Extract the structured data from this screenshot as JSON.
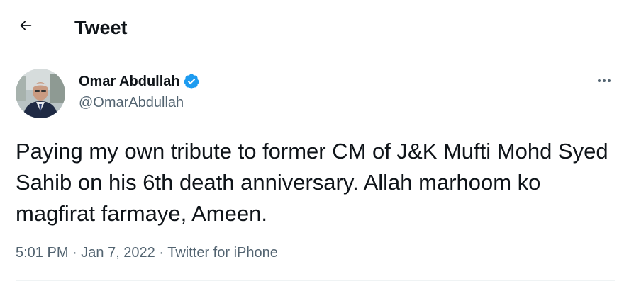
{
  "header": {
    "title": "Tweet",
    "back_icon": "arrow-left-icon"
  },
  "author": {
    "display_name": "Omar Abdullah",
    "handle": "@OmarAbdullah",
    "verified_icon": "verified-badge-icon",
    "verified_color": "#1d9bf0",
    "more_icon": "more-horizontal-icon"
  },
  "tweet": {
    "text": "Paying my own tribute to former CM of J&K Mufti Mohd Syed Sahib on his 6th death anniversary. Allah marhoom ko magfirat farmaye, Ameen.",
    "time": "5:01 PM",
    "separator": "·",
    "date": "Jan 7, 2022",
    "source": "Twitter for iPhone"
  },
  "colors": {
    "text_primary": "#0f1419",
    "text_secondary": "#536471",
    "divider": "#eff3f4"
  }
}
